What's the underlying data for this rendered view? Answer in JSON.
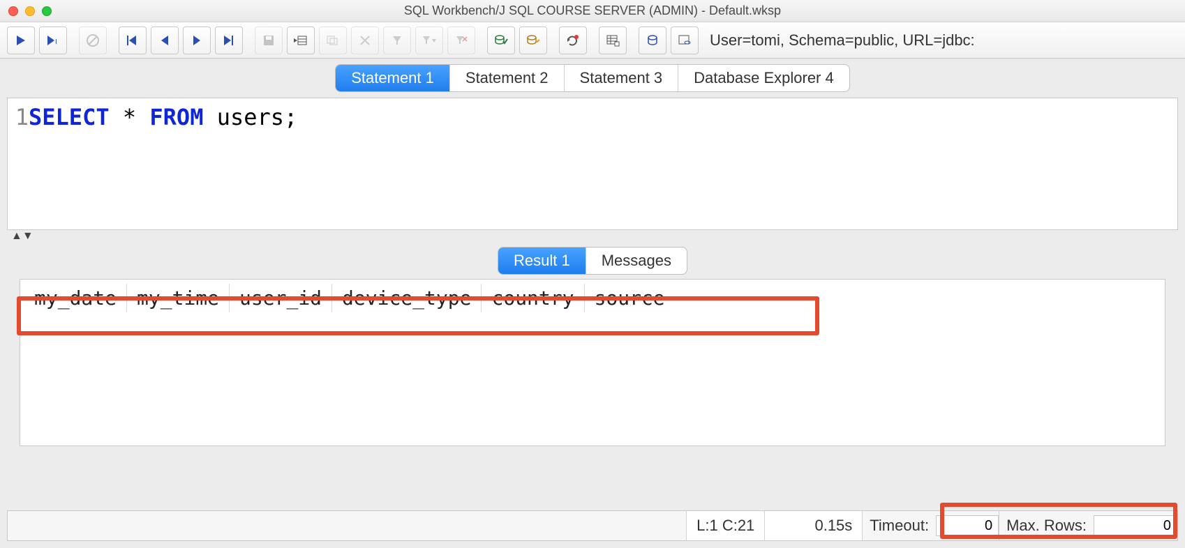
{
  "window": {
    "title": "SQL Workbench/J SQL COURSE SERVER (ADMIN) - Default.wksp"
  },
  "connection_info": "User=tomi, Schema=public, URL=jdbc:",
  "sql_tabs": [
    {
      "label": "Statement 1",
      "active": true
    },
    {
      "label": "Statement 2",
      "active": false
    },
    {
      "label": "Statement 3",
      "active": false
    },
    {
      "label": "Database Explorer 4",
      "active": false
    }
  ],
  "editor": {
    "line_number": "1",
    "tokens": {
      "select": "SELECT",
      "star": "*",
      "from": "FROM",
      "rest": "users;"
    }
  },
  "result_tabs": [
    {
      "label": "Result 1",
      "active": true
    },
    {
      "label": "Messages",
      "active": false
    }
  ],
  "result_columns": [
    "my_date",
    "my_time",
    "user_id",
    "device_type",
    "country",
    "source"
  ],
  "status": {
    "cursor": "L:1 C:21",
    "exec_time": "0.15s",
    "timeout_label": "Timeout:",
    "timeout_value": "0",
    "maxrows_label": "Max. Rows:",
    "maxrows_value": "0"
  }
}
